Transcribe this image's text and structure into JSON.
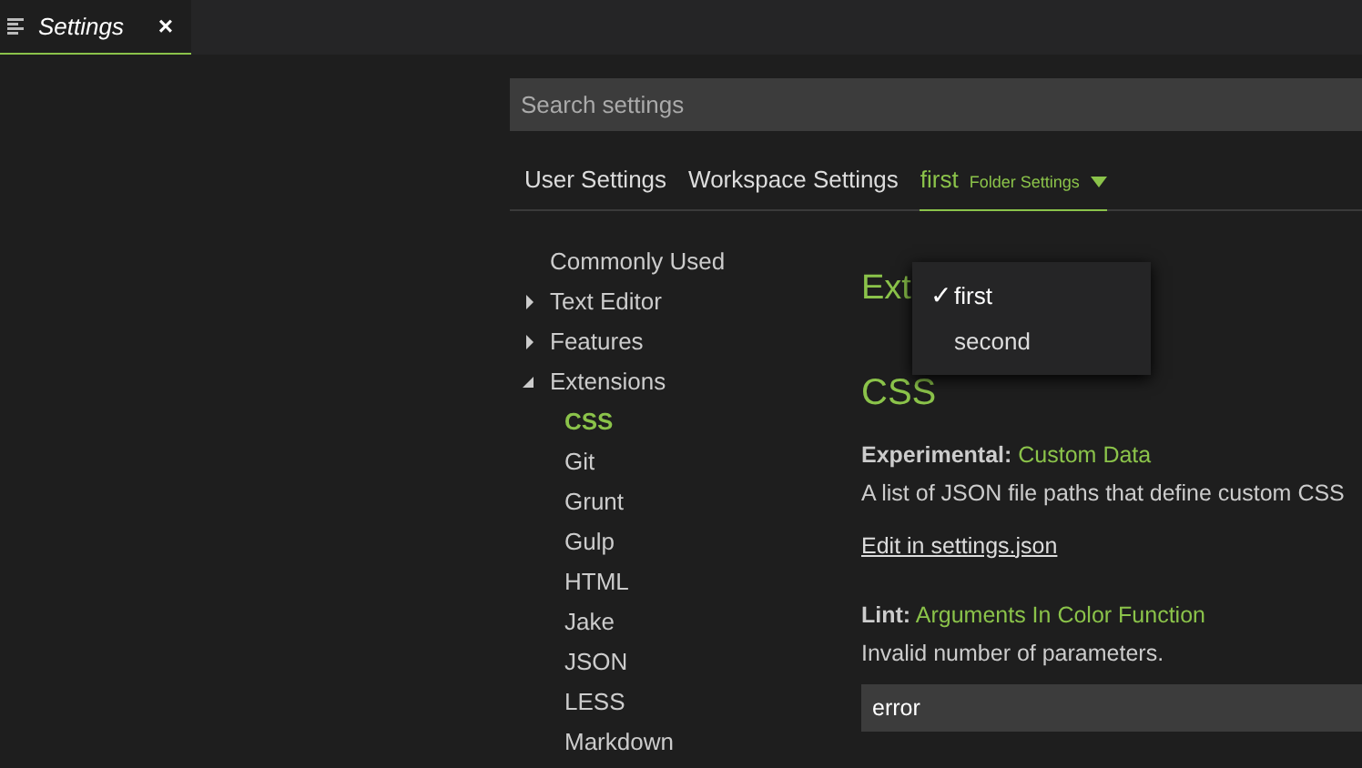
{
  "editor_tabs": [
    {
      "label": "Settings",
      "selected": true,
      "close": "×"
    }
  ],
  "search": {
    "placeholder": "Search settings"
  },
  "scope_tabs": [
    {
      "kind": "plain",
      "label": "User Settings",
      "selected": false
    },
    {
      "kind": "plain",
      "label": "Workspace Settings",
      "selected": false
    },
    {
      "kind": "folder",
      "label": "first",
      "sublabel": "Folder Settings",
      "selected": true
    }
  ],
  "folder_menu_check": "✓",
  "folder_menu": [
    {
      "label": "first",
      "selected": true
    },
    {
      "label": "second",
      "selected": false
    }
  ],
  "toc": [
    {
      "label": "Commonly Used",
      "selected": false
    },
    {
      "label": "Text Editor",
      "selected": false,
      "expanded": false
    },
    {
      "label": "Features",
      "selected": false,
      "expanded": false
    },
    {
      "label": "Extensions",
      "selected": false,
      "expanded": true,
      "children": [
        {
          "label": "CSS",
          "selected": true
        },
        {
          "label": "Git",
          "selected": false
        },
        {
          "label": "Grunt",
          "selected": false
        },
        {
          "label": "Gulp",
          "selected": false
        },
        {
          "label": "HTML",
          "selected": false
        },
        {
          "label": "Jake",
          "selected": false
        },
        {
          "label": "JSON",
          "selected": false
        },
        {
          "label": "LESS",
          "selected": false
        },
        {
          "label": "Markdown",
          "selected": false
        }
      ]
    }
  ],
  "page_heading": "Ext",
  "section_heading": "CSS",
  "settings": [
    {
      "kind": "link",
      "category": "Experimental:",
      "name": "Custom Data",
      "description": "A list of JSON file paths that define custom CSS",
      "link": "Edit in settings.json"
    },
    {
      "kind": "select",
      "category": "Lint:",
      "name": "Arguments In Color Function",
      "description": "Invalid number of parameters.",
      "value": "error"
    }
  ]
}
